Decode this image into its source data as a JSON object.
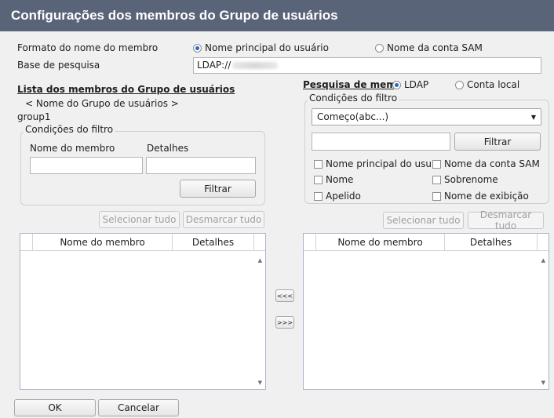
{
  "window": {
    "title": "Configurações dos membros do Grupo de usuários"
  },
  "format": {
    "label": "Formato do nome do membro",
    "option_upn": "Nome principal do usuário",
    "option_sam": "Nome da conta SAM",
    "selected": "upn"
  },
  "search_base": {
    "label": "Base de pesquisa",
    "value": "LDAP://"
  },
  "left": {
    "title": "Lista dos membros do Grupo de usuários",
    "group_name_label": "< Nome do Grupo de usuários >",
    "group_name": "group1",
    "filter_legend": "Condições do filtro",
    "member_name_label": "Nome do membro",
    "details_label": "Detalhes",
    "filter_button": "Filtrar",
    "select_all": "Selecionar tudo",
    "deselect_all": "Desmarcar tudo",
    "columns": [
      "Nome do membro",
      "Detalhes"
    ]
  },
  "right": {
    "title": "Pesquisa de membr",
    "option_ldap": "LDAP",
    "option_local": "Conta local",
    "filter_legend": "Condições do filtro",
    "condition": "Começo(abc...)",
    "filter_button": "Filtrar",
    "checkboxes": [
      "Nome principal do usuá",
      "Nome da conta SAM",
      "Nome",
      "Sobrenome",
      "Apelido",
      "Nome de exibição"
    ],
    "select_all": "Selecionar tudo",
    "deselect_all": "Desmarcar tudo",
    "columns": [
      "Nome do membro",
      "Detalhes"
    ]
  },
  "transfer": {
    "add_left": "<<<",
    "remove_right": ">>>"
  },
  "footer": {
    "ok": "OK",
    "cancel": "Cancelar"
  },
  "colors": {
    "titlebar": "#5a6478",
    "radio_dot": "#2a67c9"
  }
}
